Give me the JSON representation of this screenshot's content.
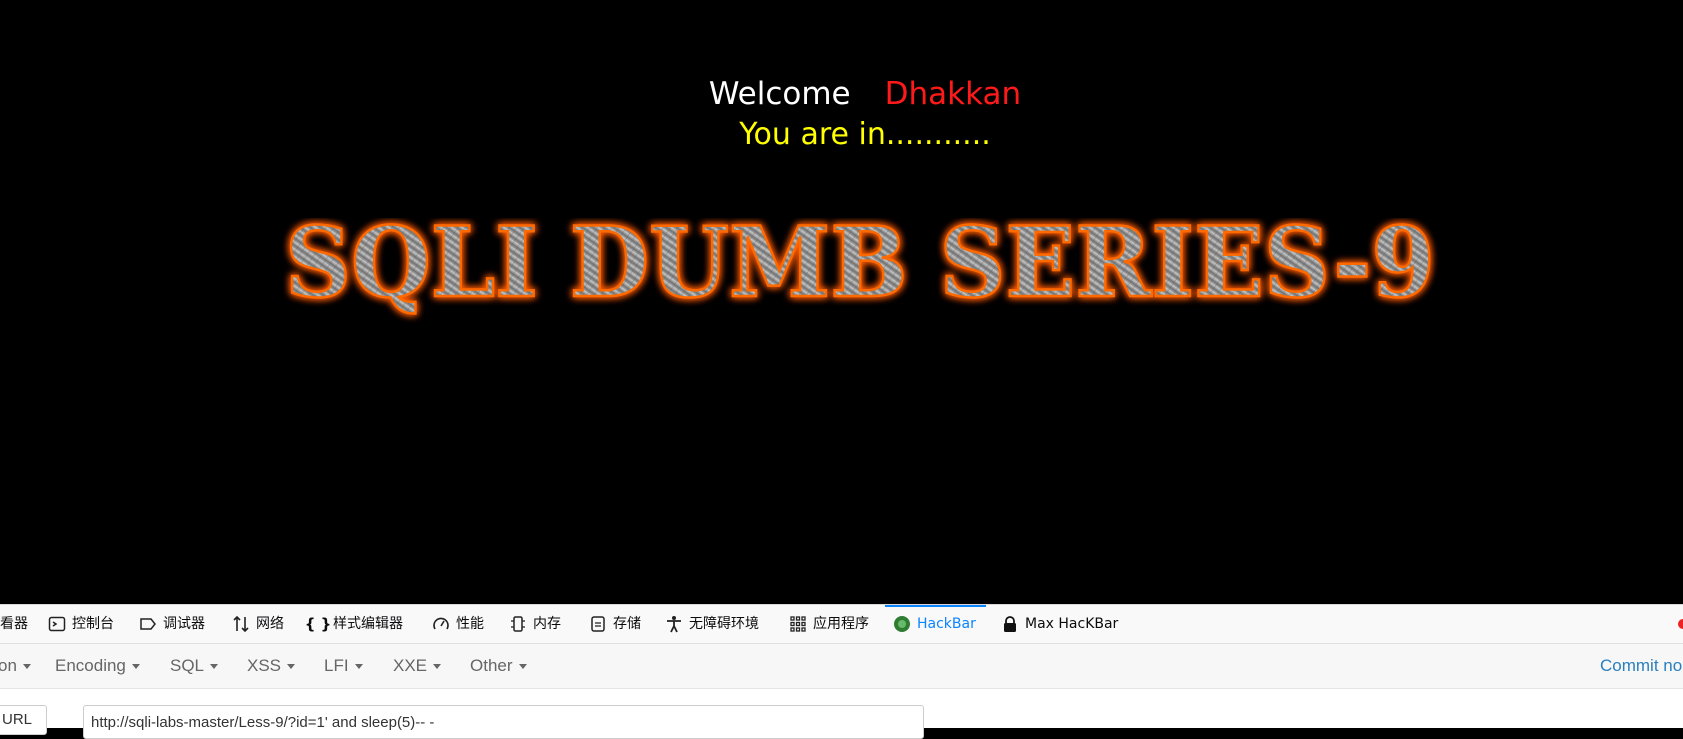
{
  "page": {
    "welcome_label": "Welcome",
    "user_name": "Dhakkan",
    "status_text": "You are in...........",
    "banner_text": "SQLI DUMB SERIES-9",
    "colors": {
      "background": "#000000",
      "welcome": "#ffffff",
      "user_name": "#ff1a1a",
      "status": "#ffff00",
      "banner_glow": "#ff6a00"
    }
  },
  "devtools": {
    "tabs": [
      {
        "label": "看器",
        "icon": "inspector-icon"
      },
      {
        "label": "控制台",
        "icon": "console-icon"
      },
      {
        "label": "调试器",
        "icon": "debugger-icon"
      },
      {
        "label": "网络",
        "icon": "network-icon"
      },
      {
        "label": "样式编辑器",
        "icon": "style-editor-icon"
      },
      {
        "label": "性能",
        "icon": "performance-icon"
      },
      {
        "label": "内存",
        "icon": "memory-icon"
      },
      {
        "label": "存储",
        "icon": "storage-icon"
      },
      {
        "label": "无障碍环境",
        "icon": "accessibility-icon"
      },
      {
        "label": "应用程序",
        "icon": "application-icon"
      },
      {
        "label": "HackBar",
        "icon": "hackbar-icon",
        "active": true
      },
      {
        "label": "Max HacKBar",
        "icon": "lock-icon"
      }
    ],
    "active_color": "#0a84ff"
  },
  "hackbar": {
    "menus": [
      "on",
      "Encoding",
      "SQL",
      "XSS",
      "LFI",
      "XXE",
      "Other"
    ],
    "commit_label": "Commit no",
    "url_button_label": "URL",
    "url_value": "http://sqli-labs-master/Less-9/?id=1' and sleep(5)-- -"
  }
}
